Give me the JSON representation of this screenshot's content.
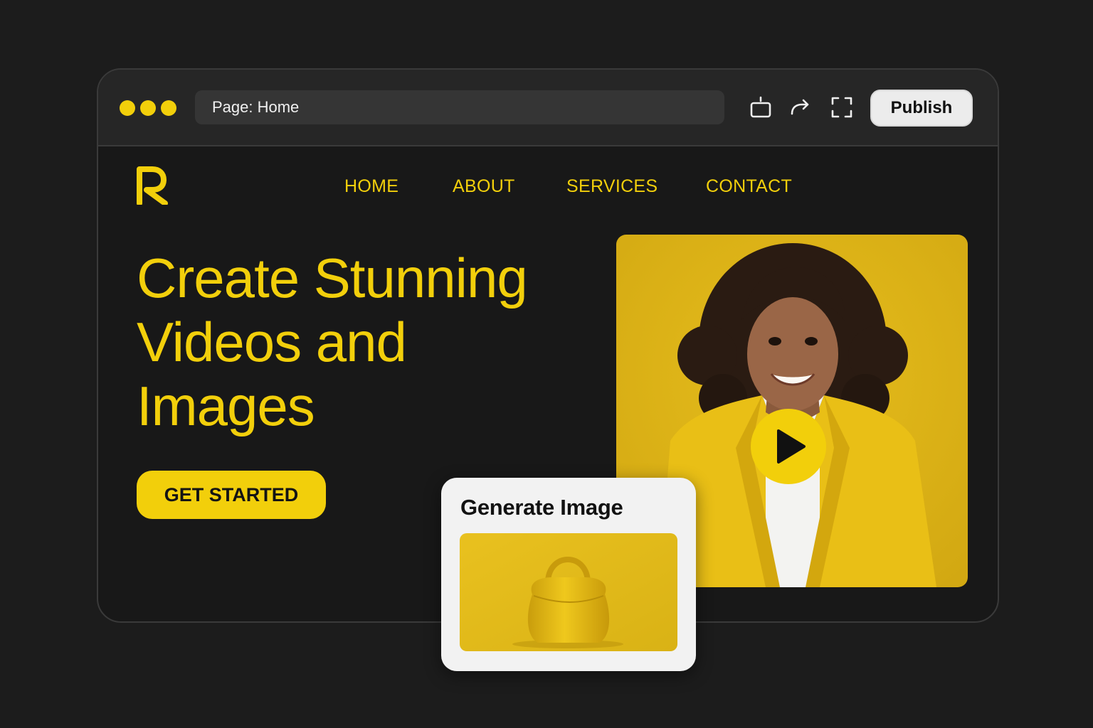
{
  "browser": {
    "address": "Page: Home",
    "publish_label": "Publish",
    "icons": [
      "window-dots-icon",
      "device-icon",
      "redo-icon",
      "fullscreen-icon"
    ]
  },
  "site": {
    "logo": "R",
    "nav": [
      "HOME",
      "ABOUT",
      "SERVICES",
      "CONTACT"
    ],
    "hero": {
      "line1": "Create Stunning",
      "line2": "Videos and",
      "line3": "Images"
    },
    "cta_label": "GET STARTED"
  },
  "card": {
    "title": "Generate Image"
  },
  "colors": {
    "accent": "#f2cf0b",
    "background": "#1c1c1c",
    "window": "#181818",
    "toolbar": "#262626"
  }
}
